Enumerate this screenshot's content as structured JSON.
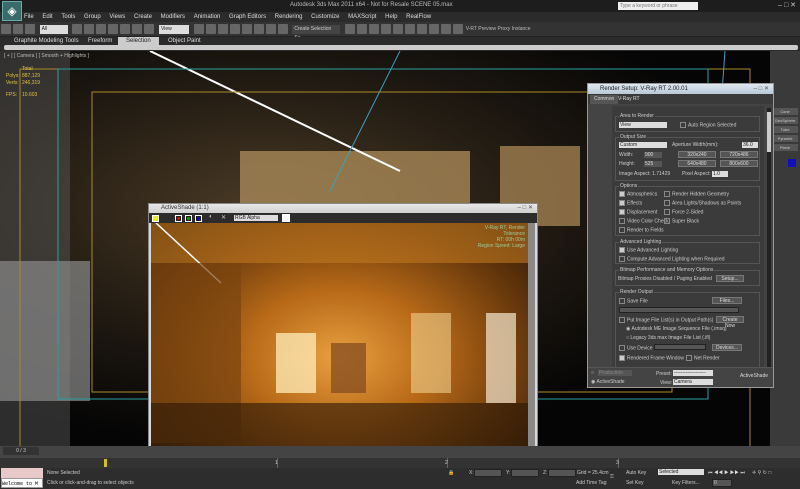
{
  "app": {
    "title": "Autodesk 3ds Max 2011 x64 - Not for Resale   SCENE 05.max",
    "logo": "3ds Max",
    "search_placeholder": "Type a keyword or phrase"
  },
  "menu": [
    "Edit",
    "Tools",
    "Group",
    "Views",
    "Create",
    "Modifiers",
    "Animation",
    "Graph Editors",
    "Rendering",
    "Customize",
    "MAXScript",
    "Help",
    "RealFlow"
  ],
  "menu_file": "File",
  "toolbar": {
    "filter": "All",
    "view": "View",
    "selection_set": "Create Selection Se",
    "vray_label": "V-RT Preview Proxy Instance"
  },
  "ribbon_tabs": [
    {
      "label": "Graphite Modeling Tools",
      "active": false
    },
    {
      "label": "Freeform",
      "active": false
    },
    {
      "label": "Selection",
      "active": true
    },
    {
      "label": "Object Paint",
      "active": false
    }
  ],
  "viewport": {
    "label": "[ + ] [ Camera ] [ Smooth + Highlights ]",
    "stats": {
      "total": "Total",
      "polys_label": "Polys:",
      "polys": "887,129",
      "verts_label": "Verts:",
      "verts": "246,319",
      "fps_label": "FPS:",
      "fps": "10.603"
    }
  },
  "command_panel": [
    "Cone",
    "GeoSphere",
    "Tube",
    "Pyramid",
    "Plane"
  ],
  "activeshade": {
    "title": "ActiveShade (1:1)",
    "channel": "RGB Alpha",
    "overlay": [
      "V-Ray RT, Render",
      "Tolerance",
      "RT: 00h 00m",
      "Region Speed: Large"
    ]
  },
  "render_setup": {
    "title": "Render Setup: V-Ray RT 2.00.01",
    "tabs": [
      "Common",
      "V-Ray RT"
    ],
    "area_to_render": {
      "title": "Area to Render",
      "value": "View",
      "auto_region": "Auto Region Selected"
    },
    "output_size": {
      "title": "Output Size",
      "preset": "Custom",
      "aperture_label": "Aperture Width(mm):",
      "aperture": "36.0",
      "width_label": "Width:",
      "width": "900",
      "height_label": "Height:",
      "height": "525",
      "presets": [
        "320x240",
        "720x486",
        "640x480",
        "800x600"
      ],
      "image_aspect": "Image Aspect: 1.71429",
      "pixel_aspect_label": "Pixel Aspect:",
      "pixel_aspect": "1.0"
    },
    "options": {
      "title": "Options",
      "items": [
        {
          "label": "Atmospherics",
          "checked": true
        },
        {
          "label": "Render Hidden Geometry",
          "checked": false
        },
        {
          "label": "Effects",
          "checked": true
        },
        {
          "label": "Area Lights/Shadows as Points",
          "checked": false
        },
        {
          "label": "Displacement",
          "checked": true
        },
        {
          "label": "Force 2-Sided",
          "checked": false
        },
        {
          "label": "Video Color Check",
          "checked": false
        },
        {
          "label": "Super Black",
          "checked": false
        },
        {
          "label": "Render to Fields",
          "checked": false
        }
      ]
    },
    "advanced_lighting": {
      "title": "Advanced Lighting",
      "use": "Use Advanced Lighting",
      "use_checked": true,
      "compute": "Compute Advanced Lighting when Required",
      "compute_checked": false
    },
    "bitmap": {
      "title": "Bitmap Performance and Memory Options",
      "status": "Bitmap Proxies Disabled / Paging Enabled",
      "setup": "Setup..."
    },
    "render_output": {
      "title": "Render Output",
      "save_file": "Save File",
      "files": "Files...",
      "put_image": "Put Image File List(s) in Output Path(s)",
      "create_now": "Create Now",
      "autodesk_me": "Autodesk ME Image Sequence File (.imsq)",
      "legacy": "Legacy 3ds max Image File List (.ifl)",
      "use_device": "Use Device",
      "devices": "Devices...",
      "rendered_frame": "Rendered Frame Window",
      "net_render": "Net Render"
    },
    "bottom": {
      "production": "Production",
      "activeshade": "ActiveShade",
      "preset_label": "Preset:",
      "preset": "-------------------",
      "view_label": "View:",
      "view": "Camera",
      "render_button": "ActiveShade"
    }
  },
  "timeline": {
    "frame": "0 / 3",
    "ticks": [
      "1",
      "2",
      "3"
    ]
  },
  "status": {
    "maxscript": "Welcome to M",
    "selection": "None Selected",
    "prompt": "Click or click-and-drag to select objects",
    "x": "X:",
    "y": "Y:",
    "z": "Z:",
    "grid": "Grid = 25.4cm",
    "add_time_tag": "Add Time Tag",
    "auto_key": "Auto Key",
    "set_key": "Set Key",
    "key_mode": "Selected",
    "key_filters": "Key Filters...",
    "frame": "0"
  },
  "colors": {
    "viewport_frame": "#aa8a2a",
    "render_bg": "#b86a18",
    "accent": "#e0c040"
  }
}
